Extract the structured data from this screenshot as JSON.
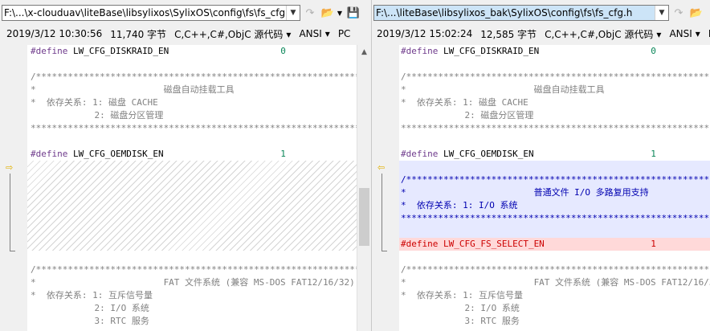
{
  "left": {
    "path": "F:\\...\\x-clouduav\\liteBase\\libsylixos\\SylixOS\\config\\fs\\fs_cfg.h",
    "timestamp": "2019/3/12 10:30:56",
    "size": "11,740 字节",
    "language": "C,C++,C#,ObjC 源代码",
    "encoding": "ANSI",
    "line_ending": "PC"
  },
  "right": {
    "path": "F:\\...\\liteBase\\libsylixos_bak\\SylixOS\\config\\fs\\fs_cfg.h",
    "timestamp": "2019/3/12 15:02:24",
    "size": "12,585 字节",
    "language": "C,C++,C#,ObjC 源代码",
    "encoding": "ANSI",
    "line_ending": "PC"
  },
  "code": {
    "diskraid": "#define LW_CFG_DISKRAID_EN                     0",
    "sep": "/*********************************************************************",
    "sep_end": "*********************************************************************",
    "autoload_title": "*                        磁盘自动挂载工具",
    "autoload_dep1": "*  依存关系: 1: 磁盘 CACHE",
    "autoload_dep2": "            2: 磁盘分区管理",
    "oemdisk": "#define LW_CFG_OEMDISK_EN                      1",
    "select_title": "*                        普通文件 I/O 多路复用支持",
    "select_dep1": "*  依存关系: 1: I/O 系统",
    "select_define": "#define LW_CFG_FS_SELECT_EN                    1",
    "fat_title": "*                        FAT 文件系统 (兼容 MS-DOS FAT12/16/32)",
    "fat_dep1": "*  依存关系: 1: 互斥信号量",
    "fat_dep2": "            2: I/O 系统",
    "fat_dep3": "            3: RTC 服务"
  },
  "icons": {
    "dropdown": "chevron-down-icon",
    "nav": "navigate-arrow-icon",
    "open": "folder-open-icon",
    "save": "save-icon",
    "diff_marker": "diff-arrow-icon"
  },
  "colors": {
    "directive": "#6f3b8c",
    "comment": "#808080",
    "number": "#098658",
    "inserted_bg": "#e6e9ff",
    "inserted_text": "#0000b0",
    "changed_bg": "#ffd9d9",
    "changed_text": "#cc0000",
    "marker": "#e0b000"
  }
}
